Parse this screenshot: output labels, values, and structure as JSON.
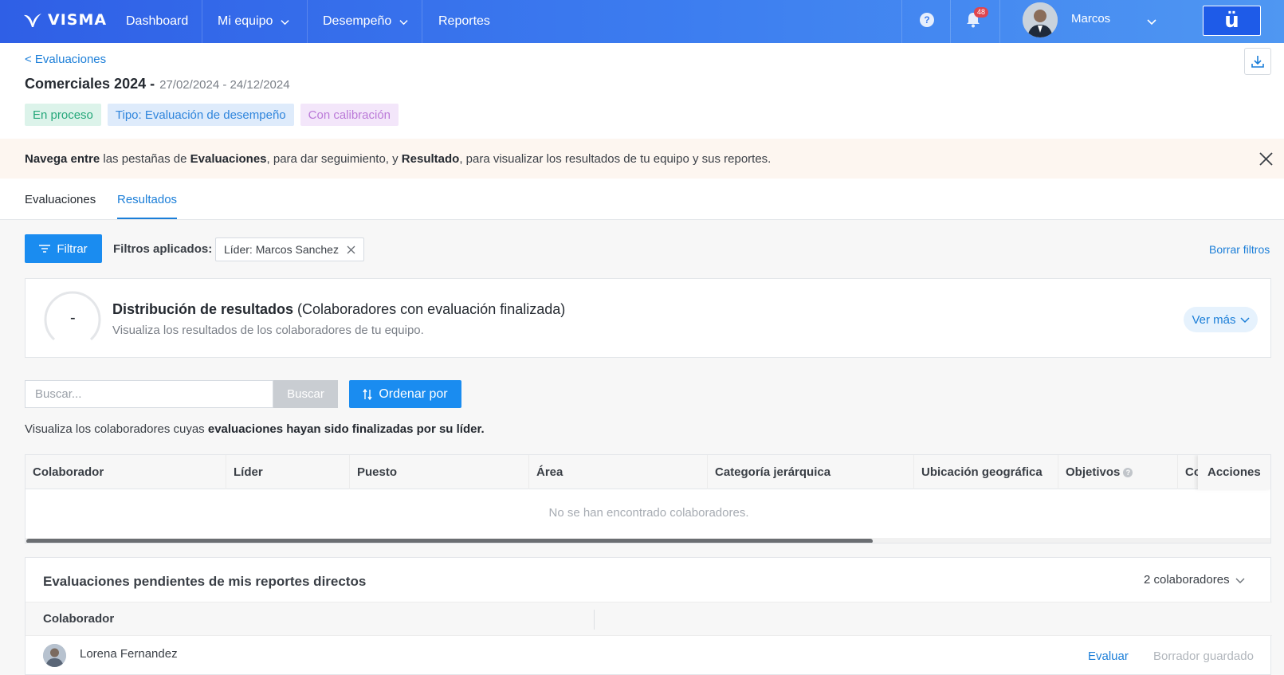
{
  "topbar": {
    "logo": "VISMA",
    "nav": [
      {
        "label": "Dashboard"
      },
      {
        "label": "Mi equipo"
      },
      {
        "label": "Desempeño"
      },
      {
        "label": "Reportes"
      }
    ],
    "notifications_count": "48",
    "user_name": "Marcos",
    "app_switch_label": "ü"
  },
  "header": {
    "back_link": "< Evaluaciones",
    "title": "Comerciales 2024 -",
    "dates": "27/02/2024 - 24/12/2024",
    "badges": [
      "En proceso",
      "Tipo: Evaluación de desempeño",
      "Con calibración"
    ]
  },
  "banner": {
    "p1": "Navega entre",
    "p2": " las pestañas de ",
    "p3": "Evaluaciones",
    "p4": ", para dar seguimiento, y ",
    "p5": "Resultado",
    "p6": ", para visualizar los resultados de tu equipo y sus reportes."
  },
  "tabs": [
    {
      "label": "Evaluaciones",
      "active": false
    },
    {
      "label": "Resultados",
      "active": true
    }
  ],
  "filters": {
    "button": "Filtrar",
    "applied_label": "Filtros aplicados:",
    "chip": "Líder: Marcos Sanchez",
    "clear": "Borrar filtros"
  },
  "distribution": {
    "gauge_value": "-",
    "title_bold": "Distribución de resultados",
    "title_rest": " (Colaboradores con evaluación finalizada)",
    "subtitle": "Visualiza los resultados de los colaboradores de tu equipo.",
    "ver_mas": "Ver más"
  },
  "search": {
    "placeholder": "Buscar...",
    "button": "Buscar",
    "sort": "Ordenar por"
  },
  "helper": {
    "normal": "Visualiza los colaboradores cuyas ",
    "bold": "evaluaciones hayan sido finalizadas por su líder."
  },
  "results_table": {
    "columns": [
      "Colaborador",
      "Líder",
      "Puesto",
      "Área",
      "Categoría jerárquica",
      "Ubicación geográfica",
      "Objetivos",
      "Co"
    ],
    "actions": "Acciones",
    "empty": "No se han encontrado colaboradores."
  },
  "pending": {
    "title": "Evaluaciones pendientes de mis reportes directos",
    "count": "2 colaboradores",
    "column": "Colaborador",
    "rows": [
      {
        "name": "Lorena Fernandez",
        "action": "Evaluar",
        "status": "Borrador guardado"
      }
    ]
  },
  "colors": {
    "primary": "#1a8cf0",
    "link": "#1b7ed8",
    "navbar_start": "#2f5fe6",
    "navbar_end": "#4f97f2",
    "badge_green": "#25a77a",
    "badge_blue": "#2f85dc",
    "badge_purple": "#bb7ad8",
    "notification": "#e0464e"
  },
  "icons": [
    "visma-logo",
    "chevron-down-icon",
    "help-icon",
    "bell-icon",
    "avatar",
    "download-icon",
    "close-icon",
    "filter-icon",
    "sort-icon",
    "info-icon"
  ]
}
